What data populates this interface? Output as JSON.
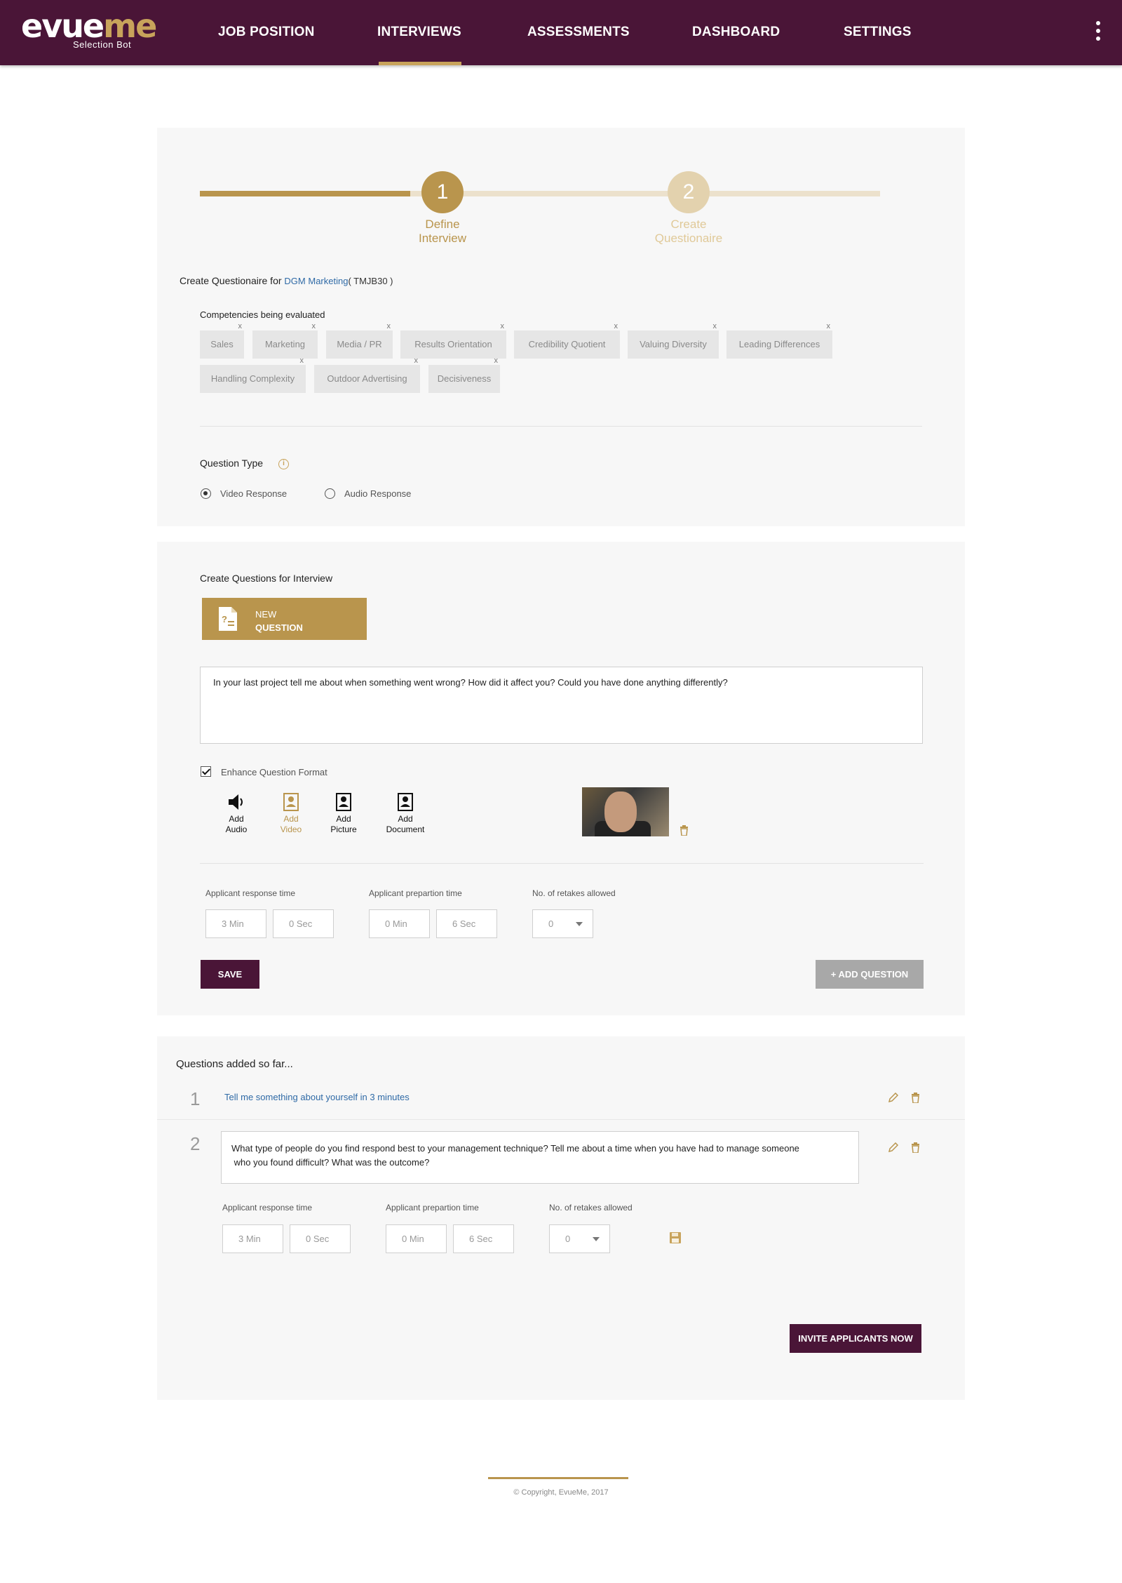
{
  "header": {
    "logo_main_a": "ev",
    "logo_main_b": "ue",
    "logo_main_c": "me",
    "logo_sub": "Selection Bot",
    "nav": [
      {
        "label": "JOB POSITION"
      },
      {
        "label": "INTERVIEWS"
      },
      {
        "label": "ASSESSMENTS"
      },
      {
        "label": "DASHBOARD"
      },
      {
        "label": "SETTINGS"
      }
    ],
    "active_nav": "INTERVIEWS"
  },
  "stepper": {
    "steps": [
      {
        "number": "1",
        "line1": "Define",
        "line2": "Interview"
      },
      {
        "number": "2",
        "line1": "Create",
        "line2": "Questionaire"
      }
    ]
  },
  "questionnaire": {
    "prefix": "Create Questionaire for",
    "company": "DGM Marketing",
    "code": "( TMJB30 )"
  },
  "competencies": {
    "title": "Competencies being evaluated",
    "remove_glyph": "x",
    "tags": [
      {
        "label": "Sales"
      },
      {
        "label": "Marketing"
      },
      {
        "label": "Media / PR"
      },
      {
        "label": "Results Orientation"
      },
      {
        "label": "Credibility Quotient"
      },
      {
        "label": "Valuing Diversity"
      },
      {
        "label": "Leading Differences"
      },
      {
        "label": "Handling Complexity"
      },
      {
        "label": "Outdoor Advertising"
      },
      {
        "label": "Decisiveness"
      }
    ]
  },
  "question_type": {
    "label": "Question Type",
    "info_glyph": "i",
    "options": [
      {
        "label": "Video Response",
        "selected": true
      },
      {
        "label": "Audio Response",
        "selected": false
      }
    ]
  },
  "create_questions": {
    "title": "Create Questions for Interview",
    "new_btn_line1": "NEW",
    "new_btn_line2": "QUESTION",
    "question_text": "In your last project tell me about when something went wrong? How did it affect you? Could you have done anything differently?",
    "enhance_label": "Enhance Question Format",
    "enhance_checked": true,
    "media": [
      {
        "line1": "Add",
        "line2": "Audio",
        "icon": "speaker-icon",
        "color": "#111111"
      },
      {
        "line1": "Add",
        "line2": "Video",
        "icon": "video-contact-icon",
        "color": "#b9954d"
      },
      {
        "line1": "Add",
        "line2": "Picture",
        "icon": "picture-contact-icon",
        "color": "#111111"
      },
      {
        "line1": "Add",
        "line2": "Document",
        "icon": "document-contact-icon",
        "color": "#111111"
      }
    ],
    "response_time_label": "Applicant response time",
    "prep_time_label": "Applicant prepartion time",
    "retakes_label": "No. of retakes allowed",
    "response_min": "3  Min",
    "response_sec": "0 Sec",
    "prep_min": "0  Min",
    "prep_sec": "6 Sec",
    "retakes": "0",
    "save_label": "SAVE",
    "add_label": "+ ADD QUESTION"
  },
  "added_questions": {
    "title": "Questions added so far...",
    "items": [
      {
        "number": "1",
        "text": "Tell me something about yourself in 3 minutes"
      },
      {
        "number": "2",
        "text": "What type of people do you find respond best to your management technique? Tell me about a time when you have had to manage someone\n who you found difficult? What was the outcome?"
      }
    ],
    "response_time_label": "Applicant response time",
    "prep_time_label": "Applicant prepartion time",
    "retakes_label": "No. of retakes allowed",
    "response_min": "3  Min",
    "response_sec": "0 Sec",
    "prep_min": "0  Min",
    "prep_sec": "6 Sec",
    "retakes": "0",
    "invite_label": "INVITE APPLICANTS NOW"
  },
  "footer": {
    "copyright": "© Copyright, EvueMe, 2017"
  },
  "colors": {
    "brand": "#4a1537",
    "accent": "#b9954d",
    "link": "#2f6aa6"
  }
}
